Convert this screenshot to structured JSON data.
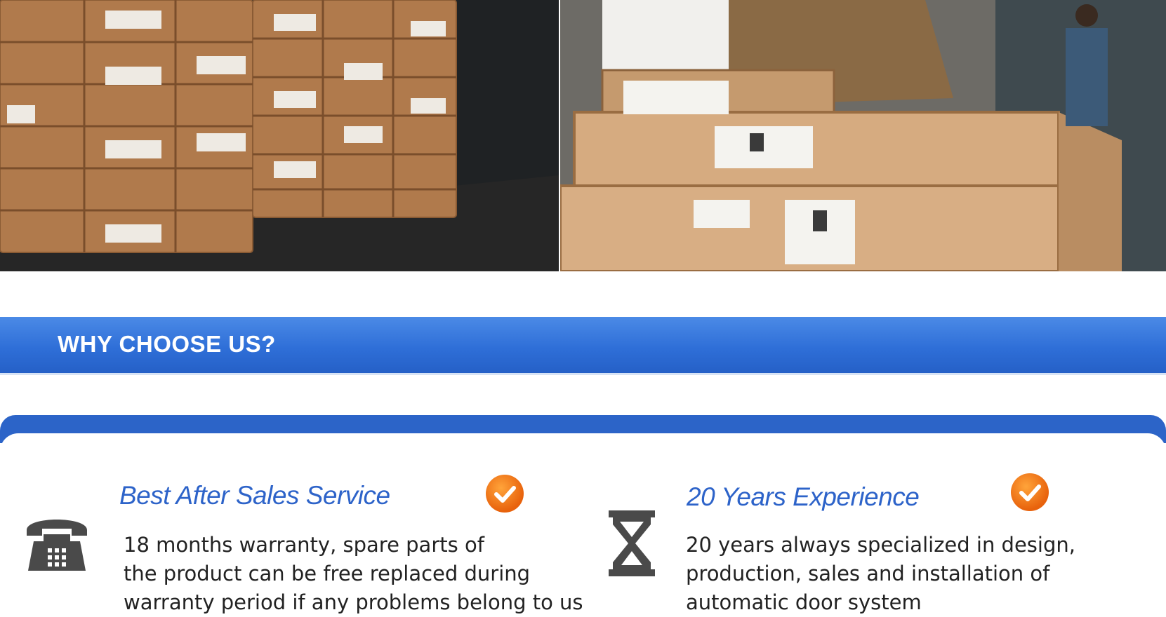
{
  "section_header": {
    "title": "WHY CHOOSE US?"
  },
  "features": [
    {
      "title": "Best After Sales Service",
      "icon": "telephone-icon",
      "badge_icon": "check-badge-icon",
      "lines": [
        "18 months warranty, spare parts of",
        "the product can be free replaced during",
        "warranty period if any problems belong to us"
      ]
    },
    {
      "title": "20 Years Experience",
      "icon": "hourglass-icon",
      "badge_icon": "check-badge-icon",
      "lines": [
        "20 years always specialized in design,",
        "production, sales and installation of",
        "automatic door system"
      ]
    }
  ],
  "colors": {
    "header_blue": "#2f6fd8",
    "title_blue": "#2d63c9",
    "badge_orange": "#e8620c"
  }
}
